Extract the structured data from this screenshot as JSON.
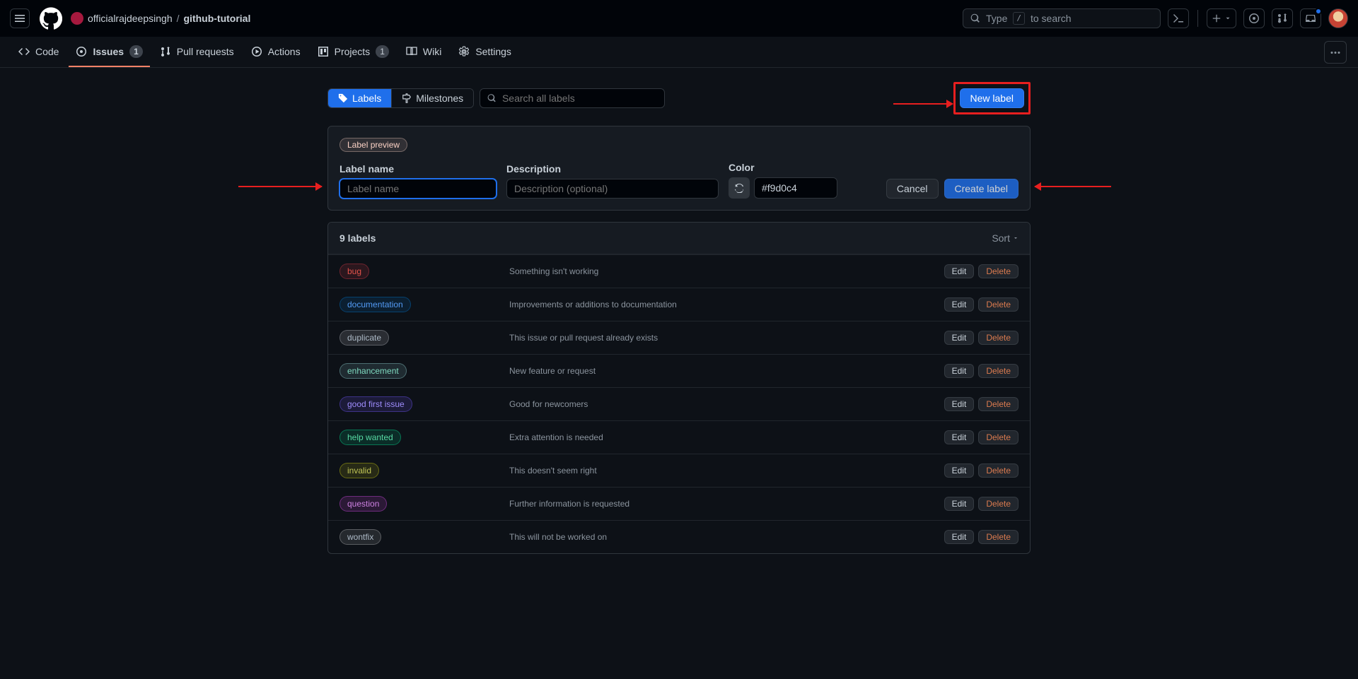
{
  "header": {
    "owner": "officialrajdeepsingh",
    "repo": "github-tutorial",
    "search_prompt_pre": "Type",
    "search_key": "/",
    "search_prompt_post": "to search"
  },
  "repo_nav": {
    "items": [
      {
        "label": "Code"
      },
      {
        "label": "Issues",
        "count": "1",
        "active": true
      },
      {
        "label": "Pull requests"
      },
      {
        "label": "Actions"
      },
      {
        "label": "Projects",
        "count": "1"
      },
      {
        "label": "Wiki"
      },
      {
        "label": "Settings"
      }
    ]
  },
  "subnav": {
    "labels": "Labels",
    "milestones": "Milestones",
    "search_placeholder": "Search all labels",
    "new_label": "New label"
  },
  "form": {
    "preview": "Label preview",
    "name_label": "Label name",
    "name_placeholder": "Label name",
    "desc_label": "Description",
    "desc_placeholder": "Description (optional)",
    "color_label": "Color",
    "color_value": "#f9d0c4",
    "cancel": "Cancel",
    "create": "Create label"
  },
  "list": {
    "count_label": "9 labels",
    "sort": "Sort",
    "edit": "Edit",
    "delete": "Delete",
    "labels": [
      {
        "name": "bug",
        "desc": "Something isn't working",
        "bg_rgba": "rgba(215,58,73,0.15)",
        "fg": "#e5534b",
        "border": "rgba(215,58,73,0.4)"
      },
      {
        "name": "documentation",
        "desc": "Improvements or additions to documentation",
        "bg_rgba": "rgba(0,117,202,0.15)",
        "fg": "#539bf5",
        "border": "rgba(0,117,202,0.4)"
      },
      {
        "name": "duplicate",
        "desc": "This issue or pull request already exists",
        "bg_rgba": "rgba(207,211,217,0.15)",
        "fg": "#adbac7",
        "border": "rgba(207,211,217,0.3)"
      },
      {
        "name": "enhancement",
        "desc": "New feature or request",
        "bg_rgba": "rgba(162,238,239,0.12)",
        "fg": "#7fdac0",
        "border": "rgba(162,238,239,0.35)"
      },
      {
        "name": "good first issue",
        "desc": "Good for newcomers",
        "bg_rgba": "rgba(112,87,255,0.15)",
        "fg": "#9e8cfc",
        "border": "rgba(112,87,255,0.4)"
      },
      {
        "name": "help wanted",
        "desc": "Extra attention is needed",
        "bg_rgba": "rgba(0,255,163,0.12)",
        "fg": "#57d9a3",
        "border": "rgba(0,255,163,0.35)"
      },
      {
        "name": "invalid",
        "desc": "This doesn't seem right",
        "bg_rgba": "rgba(229,229,16,0.12)",
        "fg": "#c0c555",
        "border": "rgba(229,229,16,0.35)"
      },
      {
        "name": "question",
        "desc": "Further information is requested",
        "bg_rgba": "rgba(216,75,235,0.15)",
        "fg": "#cc80e0",
        "border": "rgba(216,75,235,0.4)"
      },
      {
        "name": "wontfix",
        "desc": "This will not be worked on",
        "bg_rgba": "rgba(255,255,255,0.1)",
        "fg": "#adbac7",
        "border": "rgba(255,255,255,0.25)"
      }
    ]
  }
}
